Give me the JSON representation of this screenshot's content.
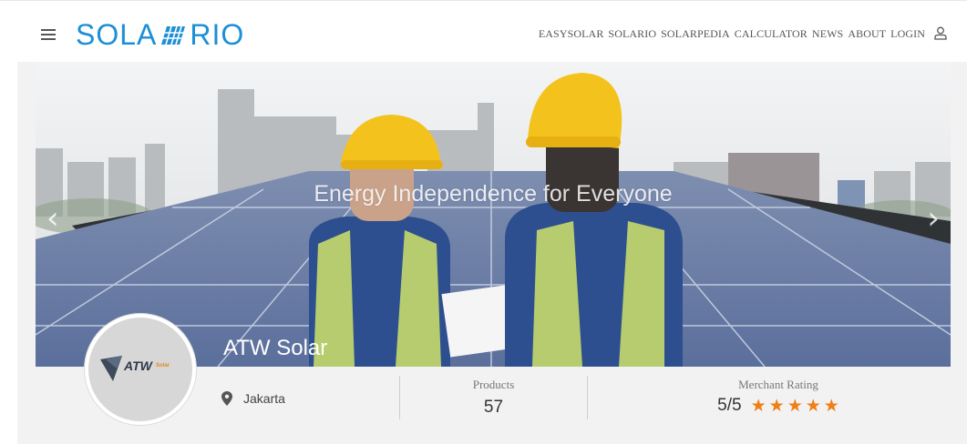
{
  "header": {
    "logo_left": "SOLA",
    "logo_right": "RIO",
    "logo_mark_icon": "solar-panel-icon",
    "menu_icon": "hamburger-menu-icon",
    "user_icon": "user-icon",
    "nav": [
      "EASYSOLAR",
      "SOLARIO",
      "SOLARPEDIA",
      "CALCULATOR",
      "NEWS",
      "ABOUT",
      "LOGIN"
    ]
  },
  "banner": {
    "slogan": "Energy Independence for Everyone",
    "prev_icon": "chevron-left-icon",
    "next_icon": "chevron-right-icon"
  },
  "merchant": {
    "name": "ATW Solar",
    "logo_text": "ATW",
    "logo_sub": "Solar",
    "location_icon": "map-pin-icon",
    "location": "Jakarta",
    "products_label": "Products",
    "products_value": "57",
    "rating_label": "Merchant Rating",
    "rating_value": "5/5",
    "rating_stars": 5
  },
  "colors": {
    "brand": "#1c8fd6",
    "star": "#f07f16"
  }
}
